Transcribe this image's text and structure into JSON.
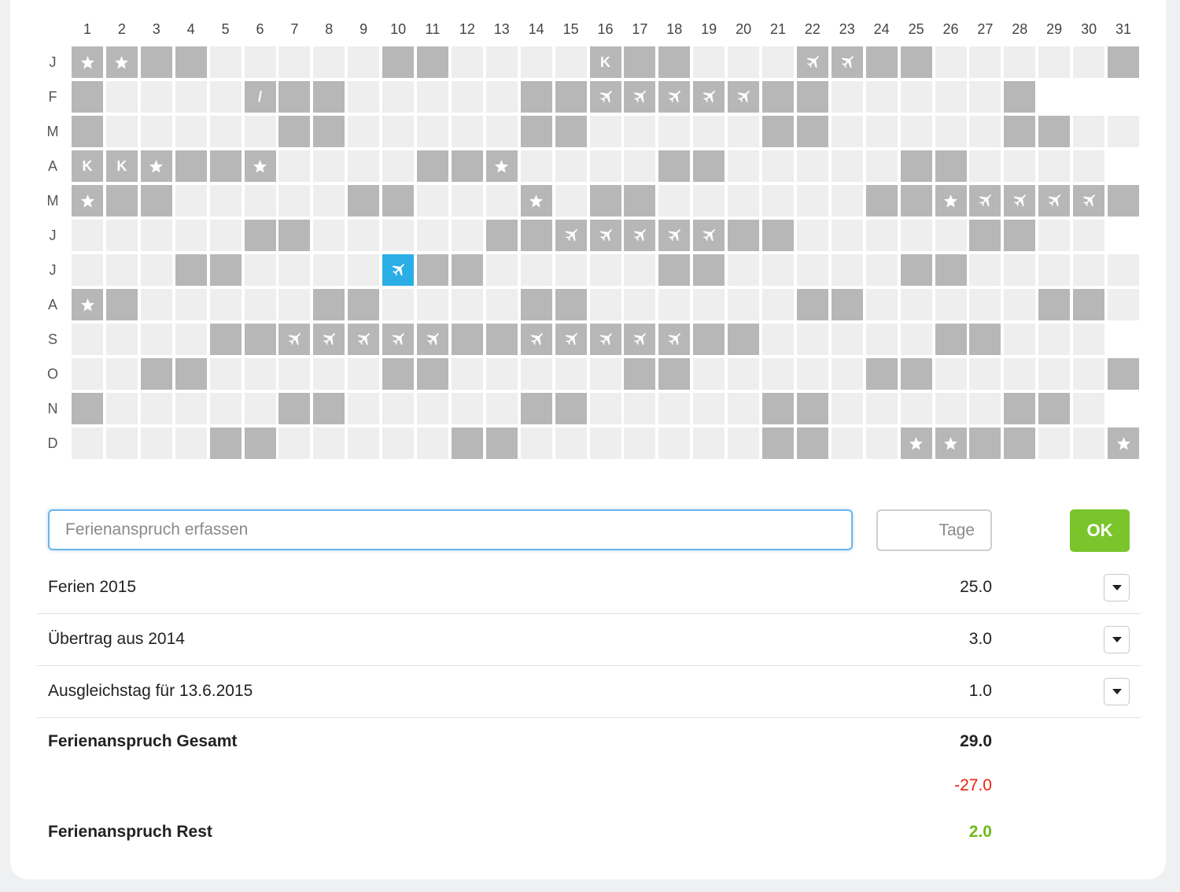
{
  "calendar": {
    "days": [
      "1",
      "2",
      "3",
      "4",
      "5",
      "6",
      "7",
      "8",
      "9",
      "10",
      "11",
      "12",
      "13",
      "14",
      "15",
      "16",
      "17",
      "18",
      "19",
      "20",
      "21",
      "22",
      "23",
      "24",
      "25",
      "26",
      "27",
      "28",
      "29",
      "30",
      "31"
    ],
    "months": [
      {
        "label": "J",
        "length": 31,
        "cells": "SSDDLLLLLDDLLLLKDDLLLPPDDLLLLLD"
      },
      {
        "label": "F",
        "length": 28,
        "cells": "DLLLL/DDLLLLLDDPPPPPDDLLLLLD"
      },
      {
        "label": "M",
        "length": 31,
        "cells": "DLLLLLDDLLLLLDDLLLLLDDLLLLLDDLL"
      },
      {
        "label": "A",
        "length": 30,
        "cells": "KKSDDSLLLLDDSLLLLDDLLLLLDDLLLL"
      },
      {
        "label": "M",
        "length": 31,
        "cells": "SDDLLLLLDDLLLSLDDLLLLLLDDSPPPPDD"
      },
      {
        "label": "J",
        "length": 30,
        "cells": "LLLLLDDLLLLLDDPPPPPDDLLLLLDDLL"
      },
      {
        "label": "J",
        "length": 31,
        "cells": "LLLDDLLLLXDDLLLLLDDLLLLLDDLLLLL"
      },
      {
        "label": "A",
        "length": 31,
        "cells": "SDLLLLLDDLLLLDDLLLLLLDDLLLLLDDL"
      },
      {
        "label": "S",
        "length": 30,
        "cells": "LLLLDDPPPPPDDPPPPPDDLLLLLDDLLL"
      },
      {
        "label": "O",
        "length": 31,
        "cells": "LLDDLLLLLDDLLLLLDDLLLLLDDLLLLLD"
      },
      {
        "label": "N",
        "length": 30,
        "cells": "DLLLLLDDLLLLLDDLLLLLDDLLLLLDDL"
      },
      {
        "label": "D",
        "length": 31,
        "cells": "LLLLDDLLLLLDDLLLLLLLDDLLSSDDLLS"
      }
    ]
  },
  "form": {
    "entitlement_placeholder": "Ferienanspruch erfassen",
    "days_placeholder": "Tage",
    "ok_label": "OK"
  },
  "entries": [
    {
      "label": "Ferien 2015",
      "value": "25.0"
    },
    {
      "label": "Übertrag aus 2014",
      "value": "3.0"
    },
    {
      "label": "Ausgleichstag für 13.6.2015",
      "value": "1.0"
    }
  ],
  "summary": {
    "total_label": "Ferienanspruch Gesamt",
    "total_value": "29.0",
    "used_value": "-27.0",
    "rest_label": "Ferienanspruch Rest",
    "rest_value": "2.0"
  },
  "colors": {
    "weekday": "#eeeeee",
    "weekend": "#b7b7b7",
    "selected": "#2baee6",
    "ok_button": "#7ac52c",
    "negative": "#e8230e",
    "positive": "#6fba1c"
  },
  "icons": {
    "star": "star-icon",
    "plane": "plane-icon",
    "half_day": "slash-mark",
    "compensation": "K-mark"
  }
}
